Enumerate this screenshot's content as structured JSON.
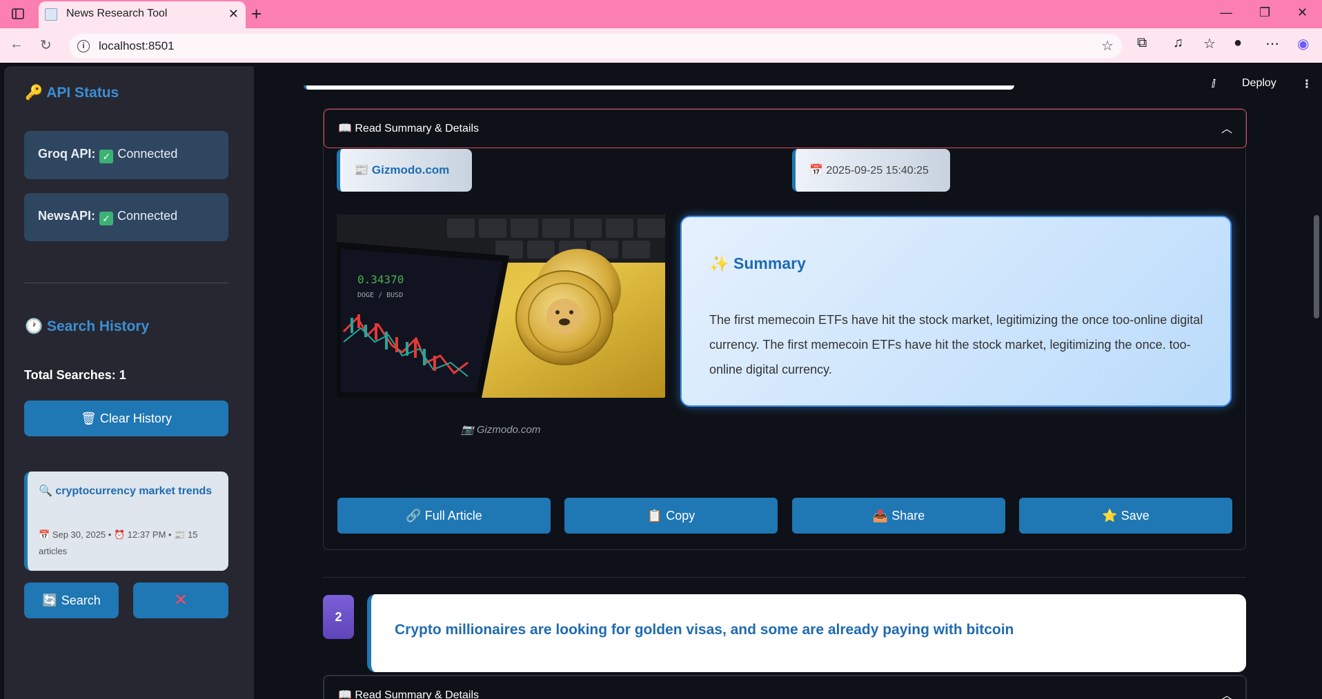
{
  "browser": {
    "tab_title": "News Research Tool",
    "url": "localhost:8501"
  },
  "sidebar": {
    "api_status_heading": "API Status",
    "api_status": [
      {
        "name": "Groq API:",
        "status": "Connected"
      },
      {
        "name": "NewsAPI:",
        "status": "Connected"
      }
    ],
    "search_history_heading": "Search History",
    "total_searches": "Total Searches: 1",
    "clear_history_label": "Clear History",
    "history_item": {
      "query": "cryptocurrency market trends",
      "date": "Sep 30, 2025",
      "time": "12:37 PM",
      "count": "15",
      "count_unit": "articles"
    },
    "search_button_label": "Search",
    "remove_button_label": "✕"
  },
  "toolbar": {
    "deploy_label": "Deploy"
  },
  "article1": {
    "expander_title": "Read Summary & Details",
    "source": "Gizmodo.com",
    "published": "2025-09-25 15:40:25",
    "image_caption": "Gizmodo.com",
    "summary_title": "Summary",
    "summary_text": "The first memecoin ETFs have hit the stock market, legitimizing the once too-online digital currency. The first memecoin ETFs have hit the stock market, legitimizing the once. too-online digital currency.",
    "actions": {
      "full_article": "Full Article",
      "copy": "Copy",
      "share": "Share",
      "save": "Save"
    }
  },
  "article2": {
    "number": "2",
    "title": "Crypto millionaires are looking for golden visas, and some are already paying with bitcoin",
    "expander_title": "Read Summary & Details"
  },
  "icons": {
    "key": "key-icon",
    "check": "check-icon",
    "clock": "clock-icon",
    "trash": "trash-icon",
    "magnifier": "search-icon",
    "calendar": "calendar-icon",
    "alarm": "alarm-icon",
    "newspaper": "newspaper-icon",
    "book": "book-icon",
    "sparkles": "sparkles-icon",
    "camera": "camera-icon",
    "link": "link-icon",
    "clipboard": "clipboard-icon",
    "share": "share-icon",
    "star": "star-icon"
  },
  "colors": {
    "accent": "#1f77b4",
    "sidebar_bg": "#262730",
    "main_bg": "#0e1117",
    "tabbar": "#fb7fb0",
    "summary_border": "#3d8ef0"
  }
}
